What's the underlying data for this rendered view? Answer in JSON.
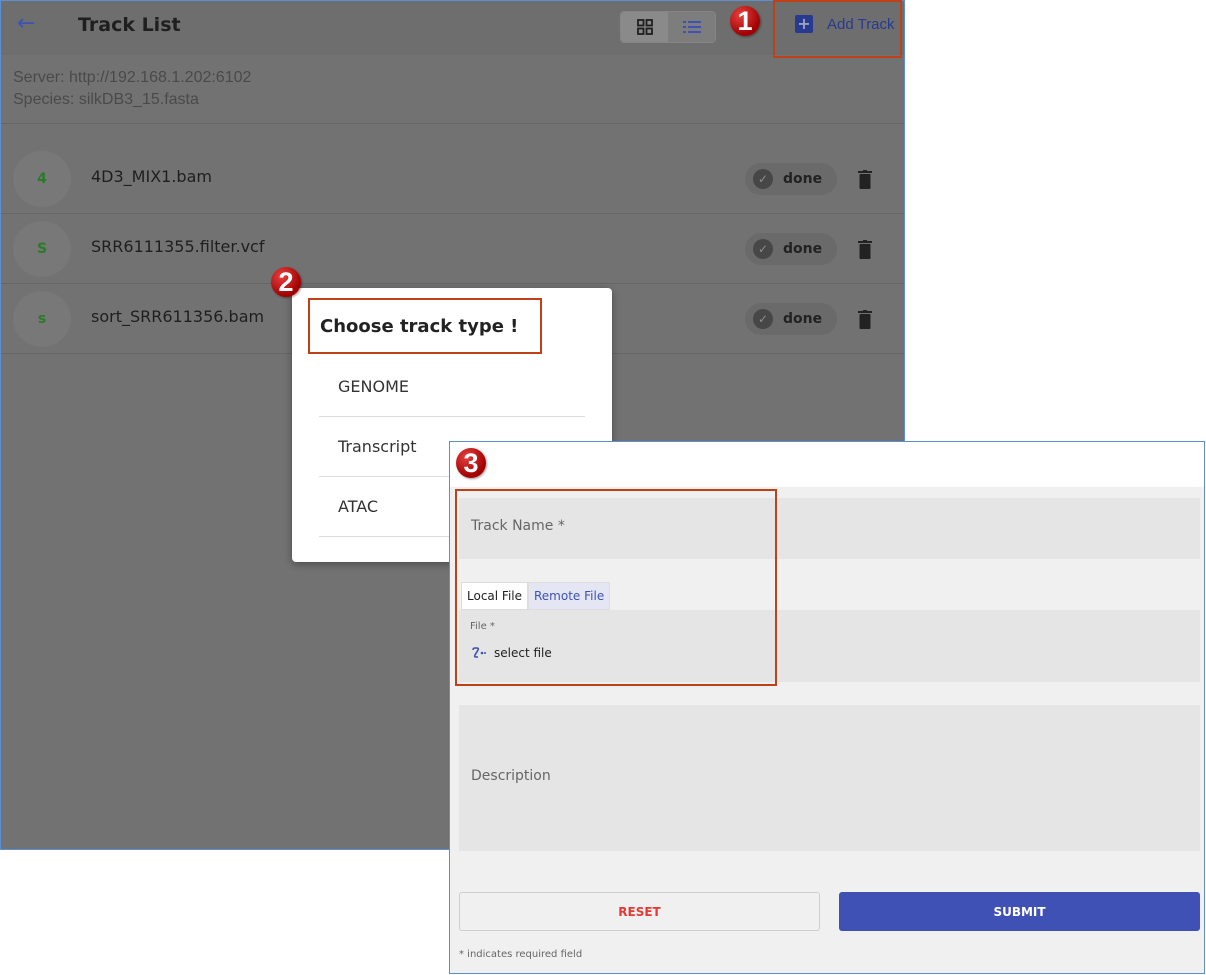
{
  "track_list": {
    "title": "Track List",
    "add_track_label": "Add Track",
    "server_line": "Server: http://192.168.1.202:6102",
    "species_line": "Species: silkDB3_15.fasta",
    "tracks": [
      {
        "avatar": "4",
        "name": "4D3_MIX1.bam",
        "status": "done"
      },
      {
        "avatar": "S",
        "name": "SRR6111355.filter.vcf",
        "status": "done"
      },
      {
        "avatar": "s",
        "name": "sort_SRR611356.bam",
        "status": "done"
      }
    ]
  },
  "dialog": {
    "title": "Choose track type !",
    "options": [
      "GENOME",
      "Transcript",
      "ATAC"
    ]
  },
  "form": {
    "track_name_placeholder": "Track Name *",
    "tabs": [
      "Local File",
      "Remote File"
    ],
    "file_label": "File *",
    "select_file": "select file",
    "description_placeholder": "Description",
    "reset_label": "RESET",
    "submit_label": "SUBMIT",
    "required_note": "* indicates required field"
  },
  "markers": [
    "1",
    "2",
    "3"
  ],
  "colors": {
    "accent": "#3f51b5",
    "highlight": "#c0401a",
    "marker": "#cc0000",
    "reset": "#e53935"
  }
}
